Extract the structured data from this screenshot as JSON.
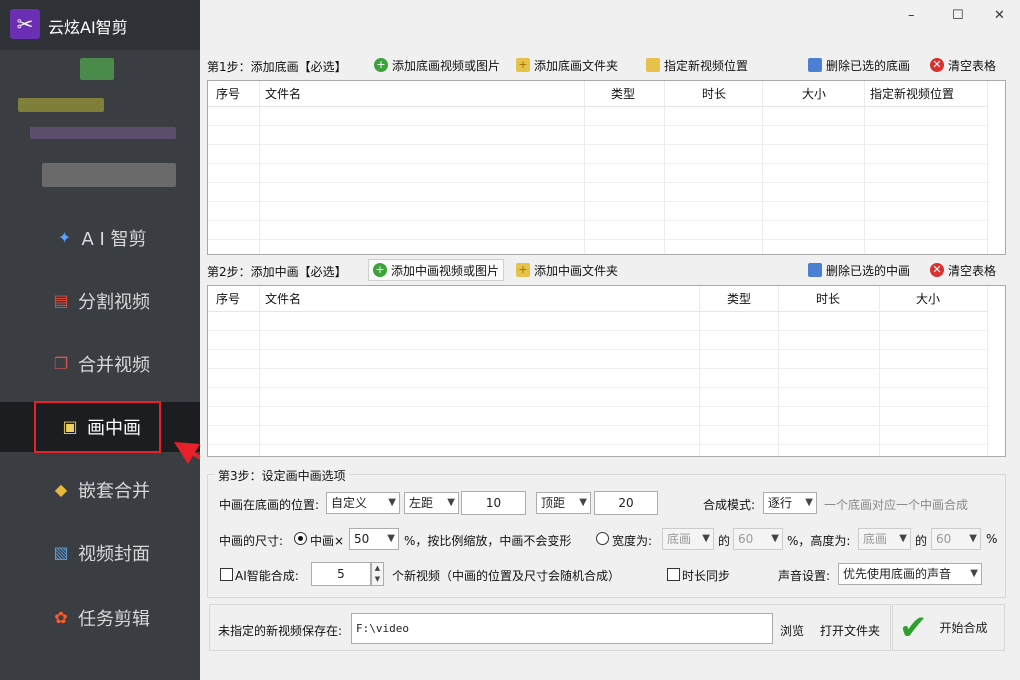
{
  "app": {
    "title": "云炫AI智剪"
  },
  "sidebar": {
    "items": [
      {
        "label": "A I 智剪",
        "icon": "ai-edit-icon"
      },
      {
        "label": "分割视频",
        "icon": "split-video-icon"
      },
      {
        "label": "合并视频",
        "icon": "merge-video-icon"
      },
      {
        "label": "画中画",
        "icon": "pip-icon"
      },
      {
        "label": "嵌套合并",
        "icon": "nest-merge-icon"
      },
      {
        "label": "视频封面",
        "icon": "video-cover-icon"
      },
      {
        "label": "任务剪辑",
        "icon": "task-edit-icon"
      }
    ],
    "active_index": 3
  },
  "window": {
    "minimize": "–",
    "maximize": "☐",
    "close": "✕"
  },
  "step1": {
    "label": "第1步：添加底画【必选】",
    "add_file": "添加底画视频或图片",
    "add_folder": "添加底画文件夹",
    "set_position": "指定新视频位置",
    "delete_selected": "删除已选的底画",
    "clear": "清空表格",
    "columns": [
      "序号",
      "文件名",
      "类型",
      "时长",
      "大小",
      "指定新视频位置"
    ]
  },
  "step2": {
    "label": "第2步：添加中画【必选】",
    "add_file": "添加中画视频或图片",
    "add_folder": "添加中画文件夹",
    "delete_selected": "删除已选的中画",
    "clear": "清空表格",
    "columns": [
      "序号",
      "文件名",
      "类型",
      "时长",
      "大小"
    ]
  },
  "step3": {
    "label": "第3步：设定画中画选项",
    "position_label": "中画在底画的位置:",
    "position_mode": "自定义",
    "margin_x_label": "左距",
    "margin_x_value": "10",
    "margin_y_label": "顶距",
    "margin_y_value": "20",
    "compose_mode_label": "合成模式:",
    "compose_mode": "逐行",
    "compose_hint": "一个底画对应一个中画合成",
    "size_label": "中画的尺寸:",
    "size_radio_label": "中画×",
    "size_scale": "50",
    "size_hint": "%，按比例缩放，中画不会变形",
    "width_label": "宽度为:",
    "width_ref": "底画",
    "of_label": "的",
    "width_pct": "60",
    "height_label": "%，高度为:",
    "height_ref": "底画",
    "height_pct": "60",
    "percent": "%",
    "ai_label": "AI智能合成:",
    "ai_count": "5",
    "ai_hint": "个新视频（中画的位置及尺寸会随机合成）",
    "duration_sync": "时长同步",
    "audio_label": "声音设置:",
    "audio_mode": "优先使用底画的声音"
  },
  "output": {
    "save_label": "未指定的新视频保存在:",
    "save_path": "F:\\video",
    "browse": "浏览",
    "open_folder": "打开文件夹",
    "start": "开始合成"
  },
  "colors": {
    "sidebar_bg": "#3a3d42",
    "active_bg": "#1b1d20",
    "highlight": "#e8202a",
    "accent_green": "#2ea02e"
  }
}
